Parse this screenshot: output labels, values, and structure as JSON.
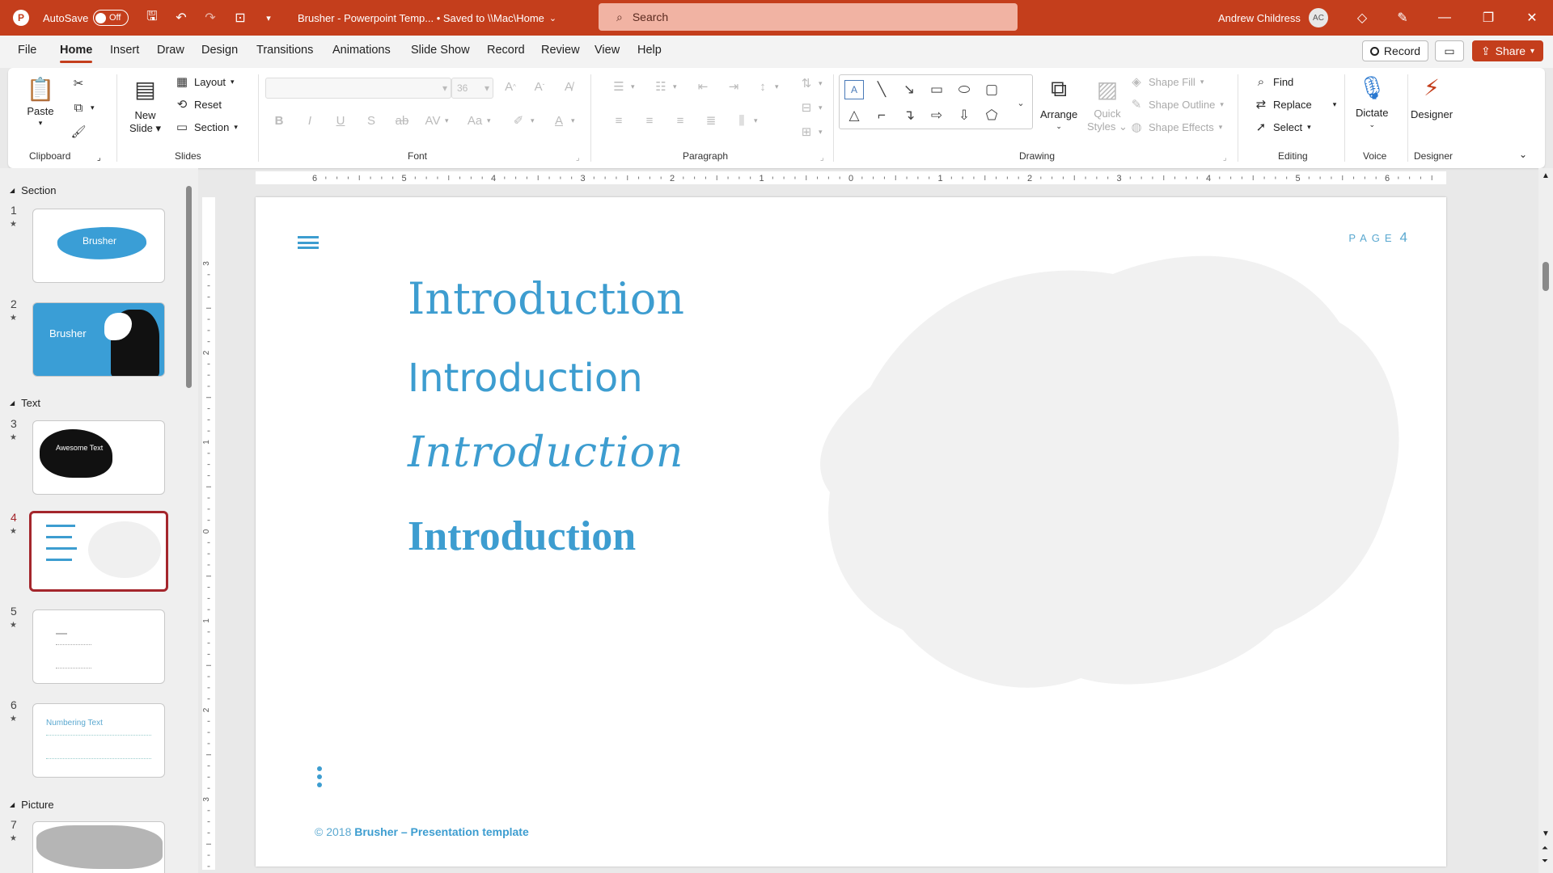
{
  "titlebar": {
    "autosave_label": "AutoSave",
    "autosave_state": "Off",
    "doc_title": "Brusher - Powerpoint Temp... • Saved to \\\\Mac\\Home",
    "search_placeholder": "Search",
    "user_name": "Andrew Childress",
    "user_initials": "AC"
  },
  "menu": {
    "tabs": [
      "File",
      "Home",
      "Insert",
      "Draw",
      "Design",
      "Transitions",
      "Animations",
      "Slide Show",
      "Record",
      "Review",
      "View",
      "Help"
    ],
    "active_tab": "Home",
    "record_button": "Record",
    "share_button": "Share"
  },
  "ribbon": {
    "clipboard": {
      "paste": "Paste",
      "group": "Clipboard"
    },
    "slides": {
      "new_slide": "New",
      "new_slide2": "Slide",
      "layout": "Layout",
      "reset": "Reset",
      "section": "Section",
      "group": "Slides"
    },
    "font": {
      "font_size": "36",
      "group": "Font"
    },
    "paragraph": {
      "group": "Paragraph"
    },
    "drawing": {
      "arrange": "Arrange",
      "quick_styles": "Quick",
      "quick_styles2": "Styles",
      "shape_fill": "Shape Fill",
      "shape_outline": "Shape Outline",
      "shape_effects": "Shape Effects",
      "group": "Drawing"
    },
    "editing": {
      "find": "Find",
      "replace": "Replace",
      "select": "Select",
      "group": "Editing"
    },
    "voice": {
      "dictate": "Dictate",
      "group": "Voice"
    },
    "designer": {
      "designer": "Designer",
      "group": "Designer"
    }
  },
  "slides_panel": {
    "sections": [
      "Section",
      "Text",
      "Picture"
    ],
    "slides": [
      {
        "num": "1",
        "caption": "Brusher"
      },
      {
        "num": "2",
        "caption": "Brusher"
      },
      {
        "num": "3",
        "caption": "Awesome Text"
      },
      {
        "num": "4",
        "caption": ""
      },
      {
        "num": "5",
        "caption": ""
      },
      {
        "num": "6",
        "caption": "Numbering Text"
      },
      {
        "num": "7",
        "caption": ""
      }
    ],
    "selected_slide": "4"
  },
  "rulers": {
    "h_ticks": [
      "6",
      "5",
      "4",
      "3",
      "2",
      "1",
      "0",
      "1",
      "2",
      "3",
      "4",
      "5",
      "6"
    ],
    "v_ticks": [
      "3",
      "2",
      "1",
      "0",
      "1",
      "2",
      "3"
    ]
  },
  "slide": {
    "page_label": "PAGE",
    "page_num": "4",
    "lines": [
      "Introduction",
      "Introduction",
      "Introduction",
      "Introduction"
    ],
    "footer_prefix": "© 2018 ",
    "footer_brand": "Brusher – Presentation template"
  },
  "colors": {
    "accent": "#c43e1c",
    "slide_blue": "#3d9dd0",
    "selection": "#a4262c"
  }
}
